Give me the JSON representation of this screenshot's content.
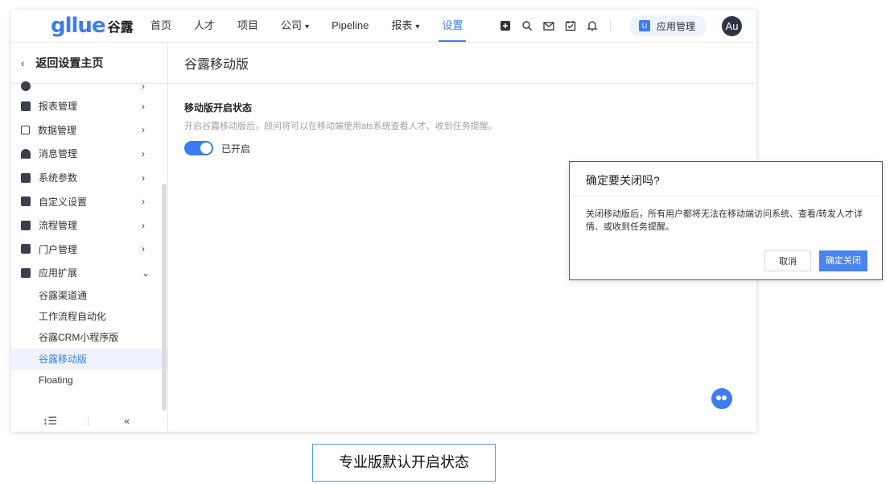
{
  "header": {
    "logo_text": "gllue",
    "logo_cn": "谷露",
    "nav": [
      {
        "label": "首页"
      },
      {
        "label": "人才"
      },
      {
        "label": "项目"
      },
      {
        "label": "公司",
        "caret": "▾"
      },
      {
        "label": "Pipeline"
      },
      {
        "label": "报表",
        "caret": "▾"
      },
      {
        "label": "设置",
        "active": true
      }
    ],
    "tool_icons": [
      "plus-square-icon",
      "search-icon",
      "mail-icon",
      "calendar-check-icon",
      "bell-icon"
    ],
    "app_management_label": "应用管理",
    "avatar_text": "Au"
  },
  "sidebar": {
    "back_label": "返回设置主页",
    "menu": [
      {
        "label": "报表管理",
        "icon": "report-icon"
      },
      {
        "label": "数据管理",
        "icon": "chart-icon"
      },
      {
        "label": "消息管理",
        "icon": "bell-icon"
      },
      {
        "label": "系统参数",
        "icon": "list-icon"
      },
      {
        "label": "自定义设置",
        "icon": "grid-icon"
      },
      {
        "label": "流程管理",
        "icon": "flow-icon"
      },
      {
        "label": "门户管理",
        "icon": "monitor-icon"
      },
      {
        "label": "应用扩展",
        "icon": "extension-icon",
        "expanded": true
      }
    ],
    "submenu": [
      {
        "label": "谷露渠道通"
      },
      {
        "label": "工作流程自动化"
      },
      {
        "label": "谷露CRM小程序版"
      },
      {
        "label": "谷露移动版",
        "selected": true
      },
      {
        "label": "Floating"
      }
    ],
    "footer": {
      "sort_icon": "↕☰",
      "collapse_icon": "«"
    }
  },
  "main": {
    "page_title": "谷露移动版",
    "section_title": "移动版开启状态",
    "section_desc": "开启谷露移动版后，顾问将可以在移动端使用ats系统查看人才、收到任务提醒。",
    "toggle_on": true,
    "toggle_label": "已开启"
  },
  "dialog": {
    "title": "确定要关闭吗?",
    "body": "关闭移动版后，所有用户都将无法在移动端访问系统、查看/转发人才详情、或收到任务提醒。",
    "cancel_label": "取消",
    "confirm_label": "确定关闭"
  },
  "caption": "专业版默认开启状态",
  "colors": {
    "accent": "#3d7cf0",
    "sidebar_selected_bg": "#eef3fd"
  }
}
